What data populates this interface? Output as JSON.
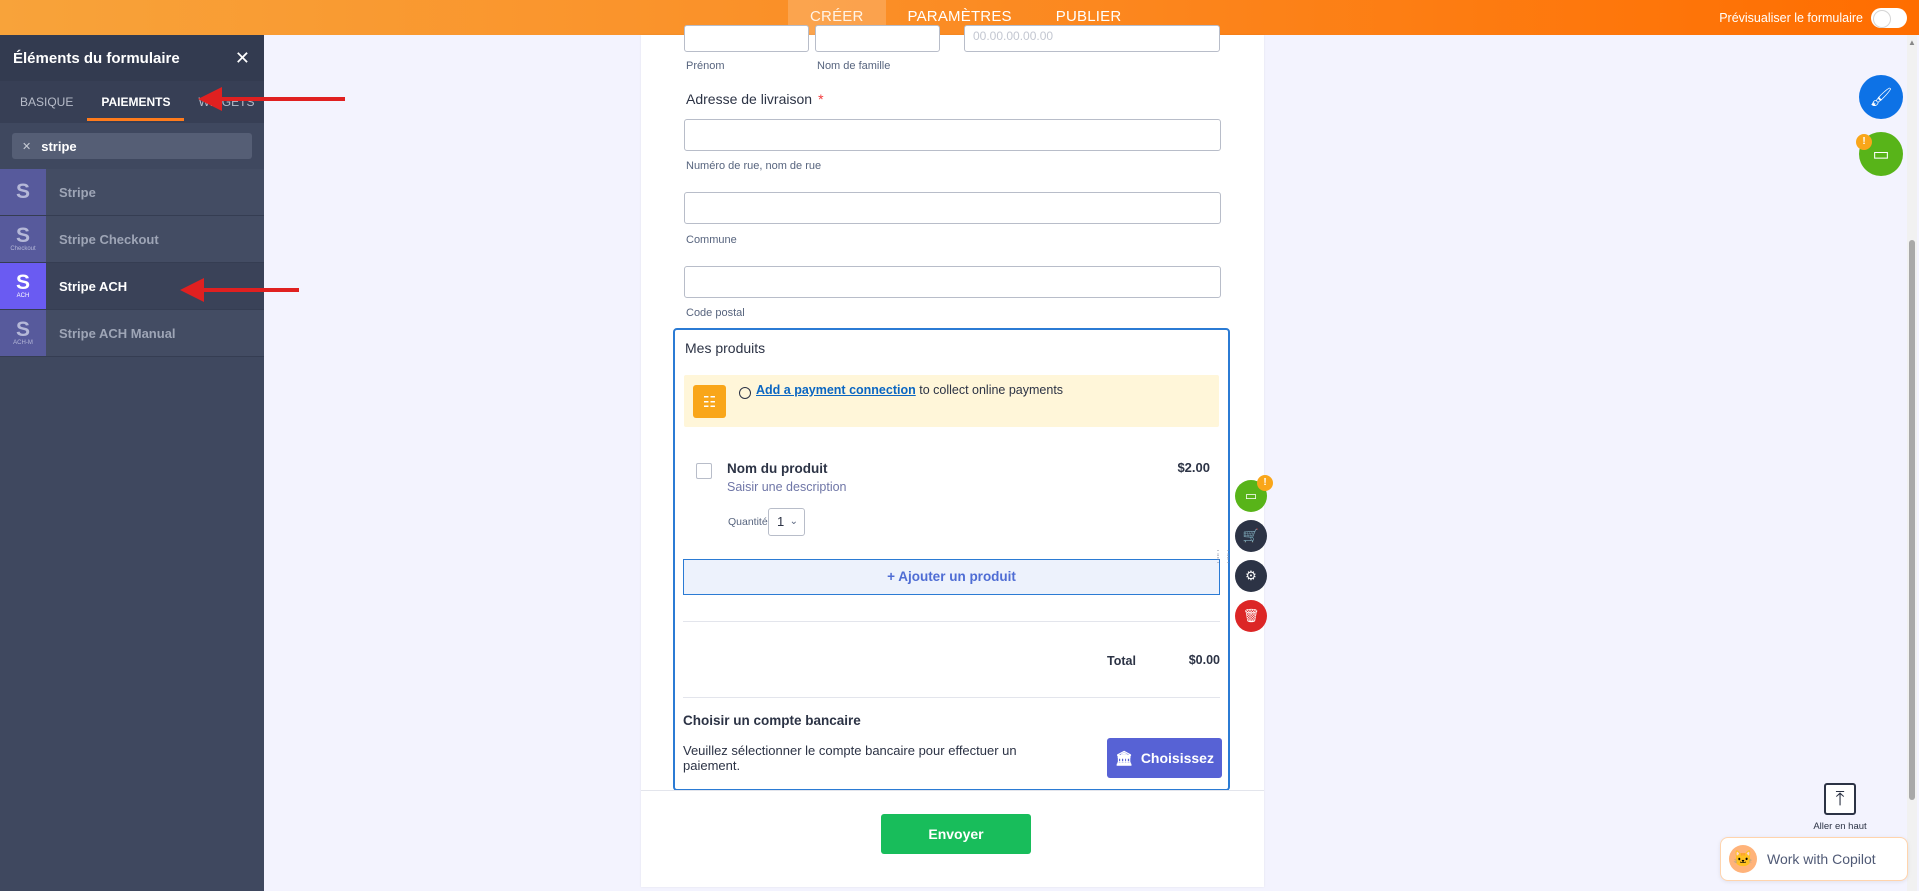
{
  "topbar": {
    "tabs": [
      "CRÉER",
      "PARAMÈTRES",
      "PUBLIER"
    ],
    "active_tab": "CRÉER",
    "preview_label": "Prévisualiser le formulaire"
  },
  "panel": {
    "title": "Éléments du formulaire",
    "tabs": [
      "BASIQUE",
      "PAIEMENTS",
      "WIDGETS"
    ],
    "active_tab": "PAIEMENTS",
    "search_value": "stripe",
    "items": [
      {
        "label": "Stripe",
        "icon_letter": "S",
        "icon_sub": ""
      },
      {
        "label": "Stripe Checkout",
        "icon_letter": "S",
        "icon_sub": "Checkout"
      },
      {
        "label": "Stripe ACH",
        "icon_letter": "S",
        "icon_sub": "ACH"
      },
      {
        "label": "Stripe ACH Manual",
        "icon_letter": "S",
        "icon_sub": "ACH-M"
      }
    ],
    "selected_item": "Stripe ACH"
  },
  "form": {
    "name_sublabels": [
      "Prénom",
      "Nom de famille"
    ],
    "phone_placeholder": "00.00.00.00.00",
    "address_label": "Adresse de livraison",
    "required_mark": "*",
    "address_sublabels": [
      "Numéro de rue, nom de rue",
      "Commune",
      "Code postal"
    ],
    "products": {
      "title": "Mes produits",
      "notice_link": "Add a payment connection",
      "notice_rest": " to collect online payments",
      "product_name": "Nom du produit",
      "product_desc": "Saisir une description",
      "product_price": "$2.00",
      "qty_label": "Quantité",
      "qty_value": "1",
      "add_button": "+ Ajouter un produit",
      "total_label": "Total",
      "total_value": "$0.00",
      "bank_title": "Choisir un compte bancaire",
      "bank_desc": "Veuillez sélectionner le compte bancaire pour effectuer un paiement.",
      "choose_button": "Choisissez"
    },
    "submit_label": "Envoyer"
  },
  "side_tools": {
    "badge": "!"
  },
  "right_fabs": {
    "badge": "!"
  },
  "goto_top_label": "Aller en haut",
  "copilot_label": "Work with Copilot",
  "colors": {
    "accent_orange": "#ff7b1c",
    "panel_bg": "#3f485f",
    "stripe_ach": "#6a5bf2",
    "submit_green": "#18bd5b",
    "selection_blue": "#2b7bd4"
  }
}
